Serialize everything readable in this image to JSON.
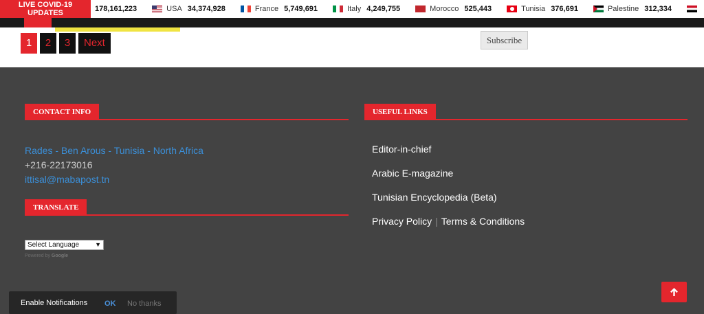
{
  "ticker": {
    "badge_line1": "LIVE COVID-19",
    "badge_line2": "UPDATES",
    "items": [
      {
        "country": "",
        "count": "178,161,223",
        "flag": ""
      },
      {
        "country": "USA",
        "count": "34,374,928",
        "flag": "us-flag-icon"
      },
      {
        "country": "France",
        "count": "5,749,691",
        "flag": "france-flag-icon"
      },
      {
        "country": "Italy",
        "count": "4,249,755",
        "flag": "italy-flag-icon"
      },
      {
        "country": "Morocco",
        "count": "525,443",
        "flag": "morocco-flag-icon"
      },
      {
        "country": "Tunisia",
        "count": "376,691",
        "flag": "tunisia-flag-icon"
      },
      {
        "country": "Palestine",
        "count": "312,334",
        "flag": "palestine-flag-icon"
      }
    ]
  },
  "pagination": {
    "pages": [
      "1",
      "2",
      "3"
    ],
    "active_page": "1",
    "next_label": "Next"
  },
  "subscribe": {
    "label": "Subscribe"
  },
  "contact": {
    "heading": "CONTACT INFO",
    "address": "Rades - Ben Arous - Tunisia - North Africa",
    "phone": "+216-22173016",
    "email": "ittisal@mabapost.tn"
  },
  "translate": {
    "heading": "TRANSLATE",
    "select_value": "Select Language",
    "powered_by": "Powered by",
    "powered_brand": "Google"
  },
  "useful_links": {
    "heading": "USEFUL LINKS",
    "items": [
      "Editor-in-chief",
      "Arabic E-magazine",
      "Tunisian Encyclopedia (Beta)"
    ],
    "privacy": "Privacy Policy",
    "separator": "|",
    "terms": "Terms & Conditions"
  },
  "notification": {
    "title": "Enable Notifications",
    "ok": "OK",
    "no": "No thanks"
  },
  "colors": {
    "accent": "#e4262d",
    "footer_bg": "#434343",
    "link": "#3b8fd8"
  },
  "icons": {
    "scroll_top": "arrow-up-icon"
  }
}
